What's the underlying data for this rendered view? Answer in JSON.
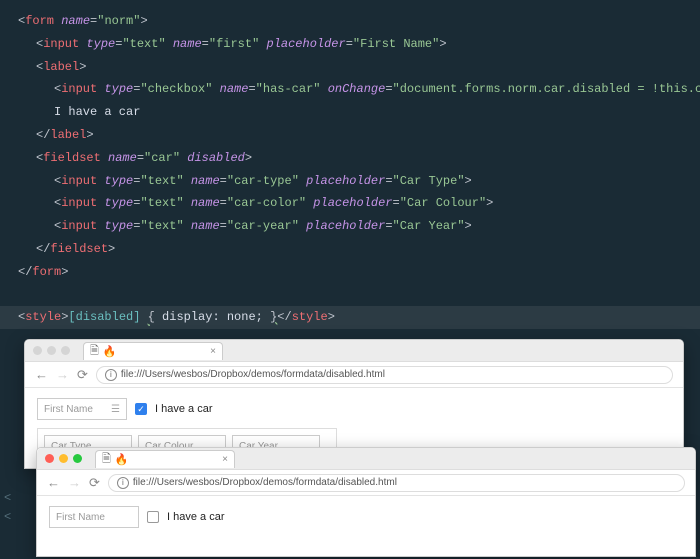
{
  "code": {
    "form_tag": "form",
    "form_name_attr": "name",
    "form_name_val": "norm",
    "input_tag": "input",
    "type_attr": "type",
    "name_attr": "name",
    "ph_attr": "placeholder",
    "oc_attr": "onChange",
    "text_val": "text",
    "checkbox_val": "checkbox",
    "first_val": "first",
    "first_ph": "First Name",
    "label_tag": "label",
    "hascar_val": "has-car",
    "oc_val": "document.forms.norm.car.disabled = !this.checked",
    "label_text": "I have a car",
    "label_close": "label",
    "fieldset_tag": "fieldset",
    "car_val": "car",
    "disabled_attr": "disabled",
    "cartype_val": "car-type",
    "cartype_ph": "Car Type",
    "carcolor_val": "car-color",
    "carcolor_ph": "Car Colour",
    "caryear_val": "car-year",
    "caryear_ph": "Car Year",
    "fieldset_close": "fieldset",
    "form_close": "form",
    "style_tag": "style",
    "style_rule_sel": "[disabled]",
    "style_rule_body": "display: none;",
    "style_close": "style"
  },
  "browser": {
    "tab_icon": "🔥",
    "url": "file:///Users/wesbos/Dropbox/demos/formdata/disabled.html",
    "first_name_ph": "First Name",
    "checkbox_label": "I have a car",
    "car_type_ph": "Car Type",
    "car_colour_ph": "Car Colour",
    "car_year_ph": "Car Year"
  }
}
